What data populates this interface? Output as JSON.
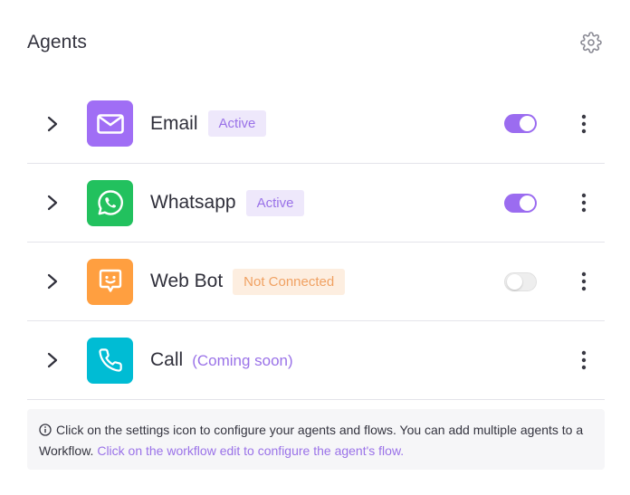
{
  "header": {
    "title": "Agents",
    "settings_icon": "gear-icon"
  },
  "agents": [
    {
      "name": "Email",
      "badge": "Active",
      "badge_type": "active",
      "icon": "mail-icon",
      "icon_bg": "#a06ef5",
      "toggle": "on"
    },
    {
      "name": "Whatsapp",
      "badge": "Active",
      "badge_type": "active",
      "icon": "whatsapp-icon",
      "icon_bg": "#22c15e",
      "toggle": "on"
    },
    {
      "name": "Web Bot",
      "badge": "Not Connected",
      "badge_type": "not-connected",
      "icon": "chat-bot-icon",
      "icon_bg": "#ff9f40",
      "toggle": "off"
    },
    {
      "name": "Call",
      "badge": "(Coming soon)",
      "badge_type": "coming-soon",
      "icon": "phone-icon",
      "icon_bg": "#00bcd4",
      "toggle": null
    }
  ],
  "colors": {
    "accent": "#9b6cf0",
    "divider": "#e4e4ea"
  },
  "note": {
    "text": "Click on the settings icon to configure your agents and flows. You can add multiple agents to a Workflow.",
    "link": "Click on the workflow edit to configure the agent's flow."
  }
}
